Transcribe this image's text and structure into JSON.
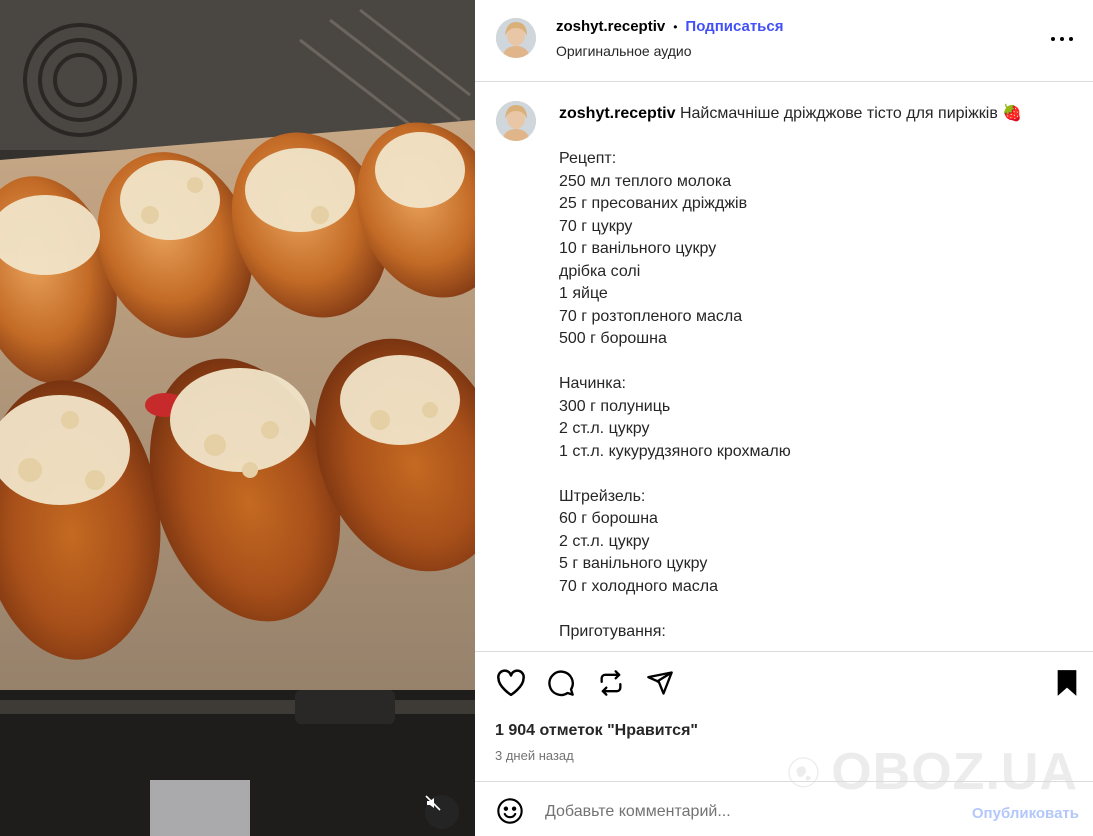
{
  "post": {
    "username": "zoshyt.receptiv",
    "follow_label": "Подписаться",
    "audio_label": "Оригинальное аудио",
    "caption_title": "Найсмачніше дріжджове тісто для пиріжків 🍓",
    "caption_lines": [
      "",
      "Рецепт:",
      "250 мл теплого молока",
      "25 г пресованих дріжджів",
      "70 г цукру",
      "10 г ванільного цукру",
      "дрібка солі",
      "1 яйце",
      "70 г розтопленого масла",
      "500 г борошна",
      "",
      "Начинка:",
      "300 г полуниць",
      "2 ст.л. цукру",
      "1 ст.л. кукурудзяного крохмалю",
      "",
      "Штрейзель:",
      "60 г борошна",
      "2 ст.л. цукру",
      "5 г ванільного цукру",
      "70 г холодного масла",
      "",
      "Приготування:"
    ],
    "likes": "1 904 отметок \"Нравится\"",
    "time_ago": "3 дней назад",
    "comment_placeholder": "Добавьте комментарий...",
    "publish_label": "Опубликовать"
  },
  "watermark": {
    "text": "OBOZ.UA"
  },
  "icons": {
    "like": "heart-icon",
    "comment": "comment-icon",
    "repost": "repost-icon",
    "share": "send-icon",
    "save": "bookmark-icon",
    "emoji": "emoji-icon",
    "mute": "muted-speaker-icon",
    "more": "more-icon"
  },
  "colors": {
    "follow": "#4150f7",
    "publish_disabled": "#b3c7fb",
    "divider": "#dbdbdb"
  }
}
